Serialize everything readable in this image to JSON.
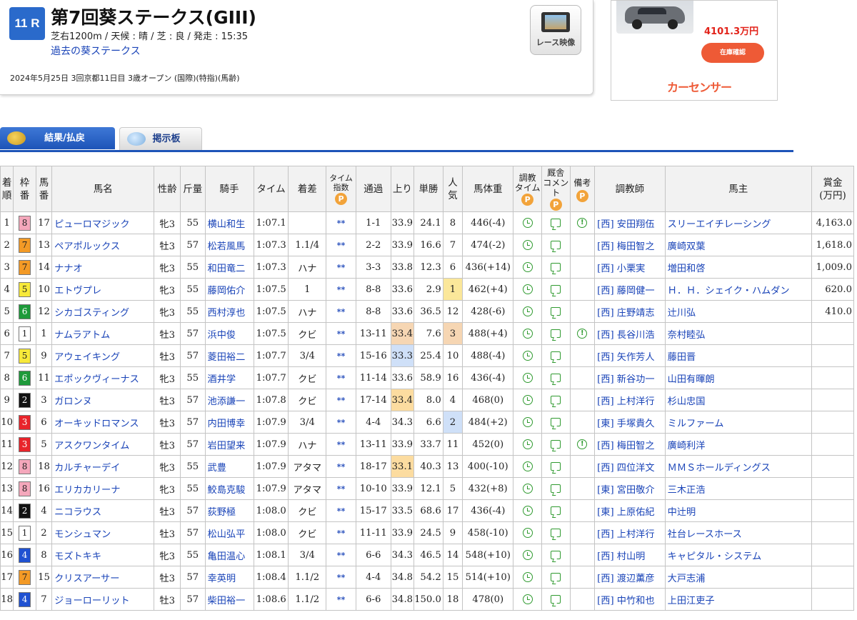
{
  "race": {
    "number": "11 R",
    "title": "第7回葵ステークス(GIII)",
    "conditions": "芝右1200m / 天候 : 晴 / 芝 : 良 / 発走 : 15:35",
    "past_link": "過去の葵ステークス",
    "date_info": "2024年5月25日 3回京都11日目 3歳オープン  (国際)(特指)(馬齢)"
  },
  "video_button": {
    "label": "レース映像",
    "icon": "film-icon"
  },
  "ad": {
    "price": "4101.3万円",
    "button": "在庫確認",
    "brand": "カーセンサー"
  },
  "tabs": [
    {
      "label": "結果/払戻",
      "icon": "coins-icon",
      "active": true
    },
    {
      "label": "掲示板",
      "icon": "chat-icon",
      "active": false
    }
  ],
  "table": {
    "headers": {
      "rank": "着\n順",
      "waku": "枠\n番",
      "umaban": "馬\n番",
      "name": "馬名",
      "sexage": "性齢",
      "weight": "斤量",
      "jockey": "騎手",
      "time": "タイム",
      "margin": "着差",
      "time_index": "タイム\n指数",
      "passing": "通過",
      "last3f": "上り",
      "odds": "単勝",
      "popularity": "人\n気",
      "horse_weight": "馬体重",
      "training_time": "調教\nタイム",
      "stable_comment": "厩舎\nコメント",
      "remarks": "備考",
      "trainer": "調教師",
      "owner": "馬主",
      "prize": "賞金\n(万円)"
    },
    "premium_mark": "P",
    "rows": [
      {
        "rank": "1",
        "waku": "8",
        "umaban": "17",
        "name": "ピューロマジック",
        "sexage": "牝3",
        "weight": "55",
        "jockey": "横山和生",
        "time": "1:07.1",
        "margin": "",
        "index": "**",
        "passing": "1-1",
        "last3f": "33.9",
        "odds": "24.1",
        "pop": "8",
        "hw": "446(-4)",
        "remark": true,
        "trainer": "[西] 安田翔伍",
        "owner": "スリーエイチレーシング",
        "prize": "4,163.0"
      },
      {
        "rank": "2",
        "waku": "7",
        "umaban": "13",
        "name": "ペアポルックス",
        "sexage": "牡3",
        "weight": "57",
        "jockey": "松若風馬",
        "time": "1:07.3",
        "margin": "1.1/4",
        "index": "**",
        "passing": "2-2",
        "last3f": "33.9",
        "odds": "16.6",
        "pop": "7",
        "hw": "474(-2)",
        "remark": false,
        "trainer": "[西] 梅田智之",
        "owner": "廣崎双葉",
        "prize": "1,618.0"
      },
      {
        "rank": "3",
        "waku": "7",
        "umaban": "14",
        "name": "ナナオ",
        "sexage": "牝3",
        "weight": "55",
        "jockey": "和田竜二",
        "time": "1:07.3",
        "margin": "ハナ",
        "index": "**",
        "passing": "3-3",
        "last3f": "33.8",
        "odds": "12.3",
        "pop": "6",
        "hw": "436(+14)",
        "remark": false,
        "trainer": "[西] 小栗実",
        "owner": "増田和啓",
        "prize": "1,009.0"
      },
      {
        "rank": "4",
        "waku": "5",
        "umaban": "10",
        "name": "エトヴプレ",
        "sexage": "牝3",
        "weight": "55",
        "jockey": "藤岡佑介",
        "time": "1:07.5",
        "margin": "1",
        "index": "**",
        "passing": "8-8",
        "last3f": "33.6",
        "odds": "2.9",
        "pop": "1",
        "hw": "462(+4)",
        "remark": false,
        "trainer": "[西] 藤岡健一",
        "owner": "Ｈ．Ｈ．シェイク・ハムダン",
        "prize": "620.0"
      },
      {
        "rank": "5",
        "waku": "6",
        "umaban": "12",
        "name": "シカゴスティング",
        "sexage": "牝3",
        "weight": "55",
        "jockey": "西村淳也",
        "time": "1:07.5",
        "margin": "ハナ",
        "index": "**",
        "passing": "8-8",
        "last3f": "33.6",
        "odds": "36.5",
        "pop": "12",
        "hw": "428(-6)",
        "remark": false,
        "trainer": "[西] 庄野靖志",
        "owner": "辻川弘",
        "prize": "410.0"
      },
      {
        "rank": "6",
        "waku": "1",
        "umaban": "1",
        "name": "ナムラアトム",
        "sexage": "牡3",
        "weight": "57",
        "jockey": "浜中俊",
        "time": "1:07.5",
        "margin": "クビ",
        "index": "**",
        "passing": "13-11",
        "last3f": "33.4",
        "odds": "7.6",
        "pop": "3",
        "hw": "488(+4)",
        "remark": true,
        "trainer": "[西] 長谷川浩",
        "owner": "奈村睦弘",
        "prize": ""
      },
      {
        "rank": "7",
        "waku": "5",
        "umaban": "9",
        "name": "アウェイキング",
        "sexage": "牡3",
        "weight": "57",
        "jockey": "菱田裕二",
        "time": "1:07.7",
        "margin": "3/4",
        "index": "**",
        "passing": "15-16",
        "last3f": "33.3",
        "odds": "25.4",
        "pop": "10",
        "hw": "488(-4)",
        "remark": false,
        "trainer": "[西] 矢作芳人",
        "owner": "藤田晋",
        "prize": ""
      },
      {
        "rank": "8",
        "waku": "6",
        "umaban": "11",
        "name": "エポックヴィーナス",
        "sexage": "牝3",
        "weight": "55",
        "jockey": "酒井学",
        "time": "1:07.7",
        "margin": "クビ",
        "index": "**",
        "passing": "11-14",
        "last3f": "33.6",
        "odds": "58.9",
        "pop": "16",
        "hw": "436(-4)",
        "remark": false,
        "trainer": "[西] 新谷功一",
        "owner": "山田有暉朗",
        "prize": ""
      },
      {
        "rank": "9",
        "waku": "2",
        "umaban": "3",
        "name": "ガロンヌ",
        "sexage": "牡3",
        "weight": "57",
        "jockey": "池添謙一",
        "time": "1:07.8",
        "margin": "クビ",
        "index": "**",
        "passing": "17-14",
        "last3f": "33.4",
        "odds": "8.0",
        "pop": "4",
        "hw": "468(0)",
        "remark": false,
        "trainer": "[西] 上村洋行",
        "owner": "杉山忠国",
        "prize": ""
      },
      {
        "rank": "10",
        "waku": "3",
        "umaban": "6",
        "name": "オーキッドロマンス",
        "sexage": "牡3",
        "weight": "57",
        "jockey": "内田博幸",
        "time": "1:07.9",
        "margin": "3/4",
        "index": "**",
        "passing": "4-4",
        "last3f": "34.3",
        "odds": "6.6",
        "pop": "2",
        "hw": "484(+2)",
        "remark": false,
        "trainer": "[東] 手塚貴久",
        "owner": "ミルファーム",
        "prize": ""
      },
      {
        "rank": "11",
        "waku": "3",
        "umaban": "5",
        "name": "アスクワンタイム",
        "sexage": "牡3",
        "weight": "57",
        "jockey": "岩田望来",
        "time": "1:07.9",
        "margin": "ハナ",
        "index": "**",
        "passing": "13-11",
        "last3f": "33.9",
        "odds": "33.7",
        "pop": "11",
        "hw": "452(0)",
        "remark": true,
        "trainer": "[西] 梅田智之",
        "owner": "廣崎利洋",
        "prize": ""
      },
      {
        "rank": "12",
        "waku": "8",
        "umaban": "18",
        "name": "カルチャーデイ",
        "sexage": "牝3",
        "weight": "55",
        "jockey": "武豊",
        "time": "1:07.9",
        "margin": "アタマ",
        "index": "**",
        "passing": "18-17",
        "last3f": "33.1",
        "odds": "40.3",
        "pop": "13",
        "hw": "400(-10)",
        "remark": false,
        "trainer": "[西] 四位洋文",
        "owner": "ＭＭＳホールディングス",
        "prize": ""
      },
      {
        "rank": "13",
        "waku": "8",
        "umaban": "16",
        "name": "エリカカリーナ",
        "sexage": "牝3",
        "weight": "55",
        "jockey": "鮫島克駿",
        "time": "1:07.9",
        "margin": "アタマ",
        "index": "**",
        "passing": "10-10",
        "last3f": "33.9",
        "odds": "12.1",
        "pop": "5",
        "hw": "432(+8)",
        "remark": false,
        "trainer": "[東] 宮田敬介",
        "owner": "三木正浩",
        "prize": ""
      },
      {
        "rank": "14",
        "waku": "2",
        "umaban": "4",
        "name": "ニコラウス",
        "sexage": "牡3",
        "weight": "57",
        "jockey": "荻野極",
        "time": "1:08.0",
        "margin": "クビ",
        "index": "**",
        "passing": "15-17",
        "last3f": "33.5",
        "odds": "68.6",
        "pop": "17",
        "hw": "436(-4)",
        "remark": false,
        "trainer": "[東] 上原佑紀",
        "owner": "中辻明",
        "prize": ""
      },
      {
        "rank": "15",
        "waku": "1",
        "umaban": "2",
        "name": "モンシュマン",
        "sexage": "牡3",
        "weight": "57",
        "jockey": "松山弘平",
        "time": "1:08.0",
        "margin": "クビ",
        "index": "**",
        "passing": "11-11",
        "last3f": "33.9",
        "odds": "24.5",
        "pop": "9",
        "hw": "458(-10)",
        "remark": false,
        "trainer": "[西] 上村洋行",
        "owner": "社台レースホース",
        "prize": ""
      },
      {
        "rank": "16",
        "waku": "4",
        "umaban": "8",
        "name": "モズトキキ",
        "sexage": "牝3",
        "weight": "55",
        "jockey": "亀田温心",
        "time": "1:08.1",
        "margin": "3/4",
        "index": "**",
        "passing": "6-6",
        "last3f": "34.3",
        "odds": "46.5",
        "pop": "14",
        "hw": "548(+10)",
        "remark": false,
        "trainer": "[西] 村山明",
        "owner": "キャピタル・システム",
        "prize": ""
      },
      {
        "rank": "17",
        "waku": "7",
        "umaban": "15",
        "name": "クリスアーサー",
        "sexage": "牡3",
        "weight": "57",
        "jockey": "幸英明",
        "time": "1:08.4",
        "margin": "1.1/2",
        "index": "**",
        "passing": "4-4",
        "last3f": "34.8",
        "odds": "54.2",
        "pop": "15",
        "hw": "514(+10)",
        "remark": false,
        "trainer": "[西] 渡辺薫彦",
        "owner": "大戸志浦",
        "prize": ""
      },
      {
        "rank": "18",
        "waku": "4",
        "umaban": "7",
        "name": "ジョーローリット",
        "sexage": "牡3",
        "weight": "57",
        "jockey": "柴田裕一",
        "time": "1:08.6",
        "margin": "1.1/2",
        "index": "**",
        "passing": "6-6",
        "last3f": "34.8",
        "odds": "150.0",
        "pop": "18",
        "hw": "478(0)",
        "remark": false,
        "trainer": "[西] 中竹和也",
        "owner": "上田江吏子",
        "prize": ""
      }
    ]
  },
  "highlights": {
    "last3f": {
      "6": "hl-or",
      "7": "hl-bl",
      "9": "hl-y2",
      "12": "hl-y2"
    },
    "pop": {
      "4": "hl-yl",
      "6": "hl-or",
      "10": "hl-bl"
    }
  },
  "waku_colors": {
    "1": {
      "bg": "#ffffff",
      "fg": "#222222"
    },
    "2": {
      "bg": "#111111",
      "fg": "#ffffff"
    },
    "3": {
      "bg": "#e8242b",
      "fg": "#ffffff"
    },
    "4": {
      "bg": "#1f51d1",
      "fg": "#ffffff"
    },
    "5": {
      "bg": "#f7e93a",
      "fg": "#222222"
    },
    "6": {
      "bg": "#1e9a3a",
      "fg": "#ffffff"
    },
    "7": {
      "bg": "#f39a26",
      "fg": "#222222"
    },
    "8": {
      "bg": "#f4a7bb",
      "fg": "#222222"
    }
  }
}
